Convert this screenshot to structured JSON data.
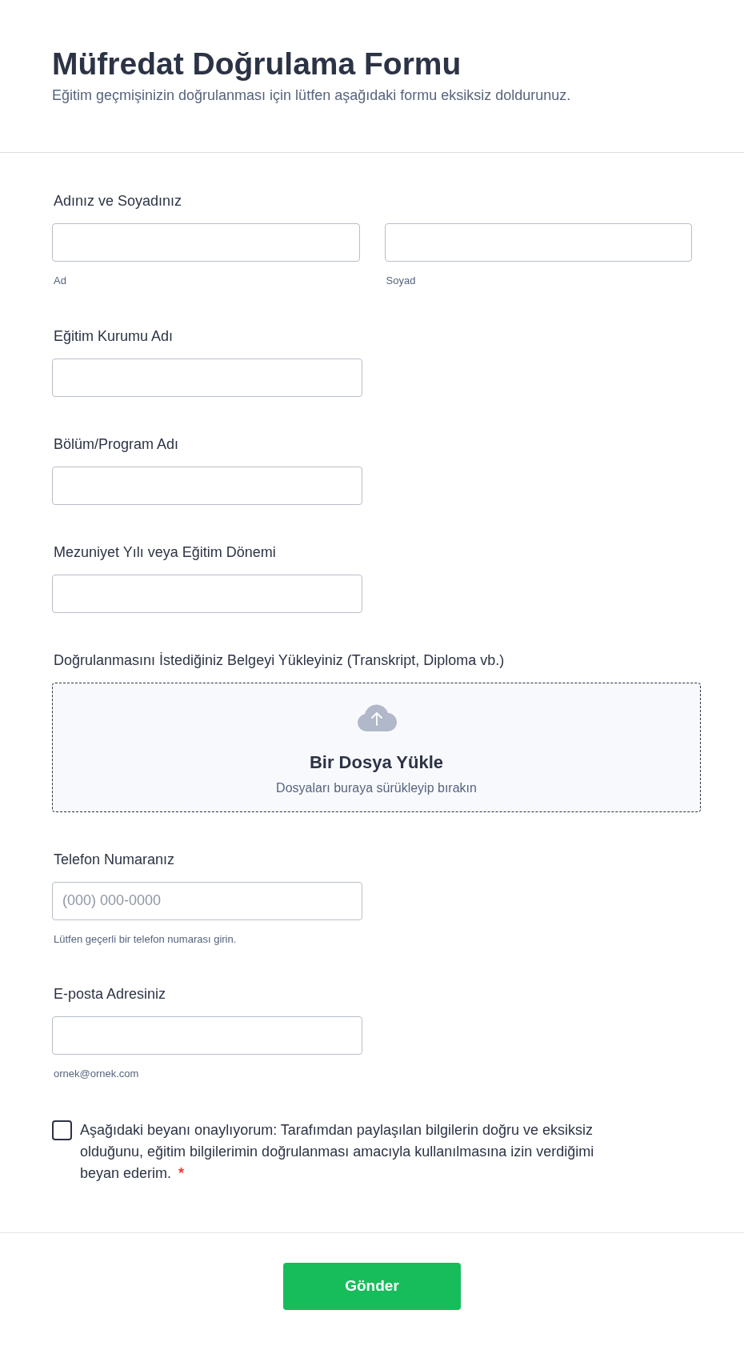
{
  "header": {
    "title": "Müfredat Doğrulama Formu",
    "description": "Eğitim geçmişinizin doğrulanması için lütfen aşağıdaki formu eksiksiz doldurunuz."
  },
  "fields": [
    {
      "kind": "name",
      "label": "Adınız ve Soyadınız",
      "parts": [
        {
          "sublabel": "Ad"
        },
        {
          "sublabel": "Soyad"
        }
      ]
    },
    {
      "kind": "text",
      "label": "Eğitim Kurumu Adı"
    },
    {
      "kind": "text",
      "label": "Bölüm/Program Adı"
    },
    {
      "kind": "text",
      "label": "Mezuniyet Yılı veya Eğitim Dönemi"
    },
    {
      "kind": "upload",
      "label": "Doğrulanmasını İstediğiniz Belgeyi Yükleyiniz (Transkript, Diploma vb.)",
      "title": "Bir Dosya Yükle",
      "hint": "Dosyaları buraya sürükleyip bırakın"
    },
    {
      "kind": "text",
      "label": "Telefon Numaranız",
      "placeholder": "(000) 000-0000",
      "sublabel": "Lütfen geçerli bir telefon numarası girin."
    },
    {
      "kind": "text",
      "label": "E-posta Adresiniz",
      "sublabel": "ornek@ornek.com"
    }
  ],
  "consent": {
    "checked": false,
    "text": "Aşağıdaki beyanı onaylıyorum: Tarafımdan paylaşılan bilgilerin doğru ve eksiksiz olduğunu, eğitim bilgilerimin doğrulanması amacıyla kullanılmasına izin verdiğimi beyan ederim.",
    "required_mark": "*"
  },
  "submit": {
    "label": "Gönder"
  }
}
